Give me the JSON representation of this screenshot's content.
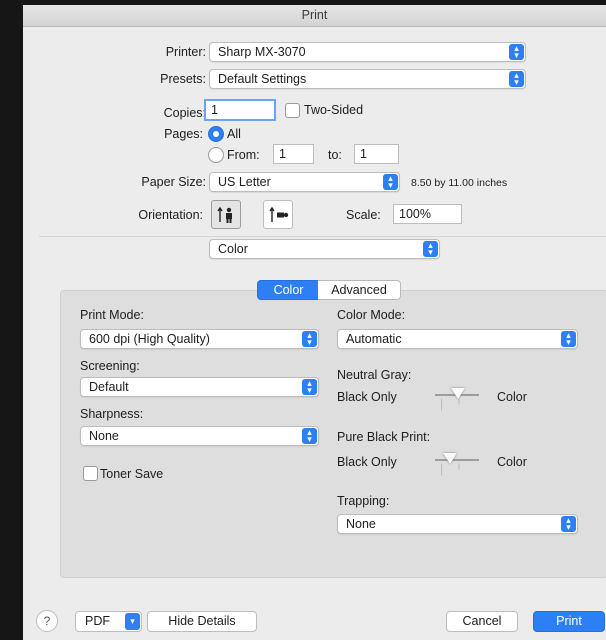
{
  "title": "Print",
  "printer": {
    "label": "Printer:",
    "value": "Sharp MX-3070"
  },
  "presets": {
    "label": "Presets:",
    "value": "Default Settings"
  },
  "copies": {
    "label": "Copies:",
    "value": "1",
    "two_sided": "Two-Sided"
  },
  "pages": {
    "label": "Pages:",
    "all": "All",
    "from": "From:",
    "from_value": "1",
    "to": "to:",
    "to_value": "1"
  },
  "paper": {
    "label": "Paper Size:",
    "value": "US Letter",
    "dims": "8.50 by 11.00 inches"
  },
  "orientation": {
    "label": "Orientation:",
    "scale_label": "Scale:",
    "scale_value": "100%"
  },
  "section_popup": "Color",
  "tabs": {
    "color": "Color",
    "advanced": "Advanced"
  },
  "color_panel": {
    "print_mode_label": "Print Mode:",
    "print_mode_value": "600 dpi (High Quality)",
    "screening_label": "Screening:",
    "screening_value": "Default",
    "sharpness_label": "Sharpness:",
    "sharpness_value": "None",
    "toner_save": "Toner Save",
    "color_mode_label": "Color Mode:",
    "color_mode_value": "Automatic",
    "neutral_gray_label": "Neutral Gray:",
    "black_only": "Black Only",
    "color": "Color",
    "pure_black_label": "Pure Black Print:",
    "trapping_label": "Trapping:",
    "trapping_value": "None"
  },
  "footer": {
    "help": "?",
    "pdf": "PDF",
    "hide_details": "Hide Details",
    "cancel": "Cancel",
    "print": "Print"
  },
  "accent_color": "#2d7ff5"
}
